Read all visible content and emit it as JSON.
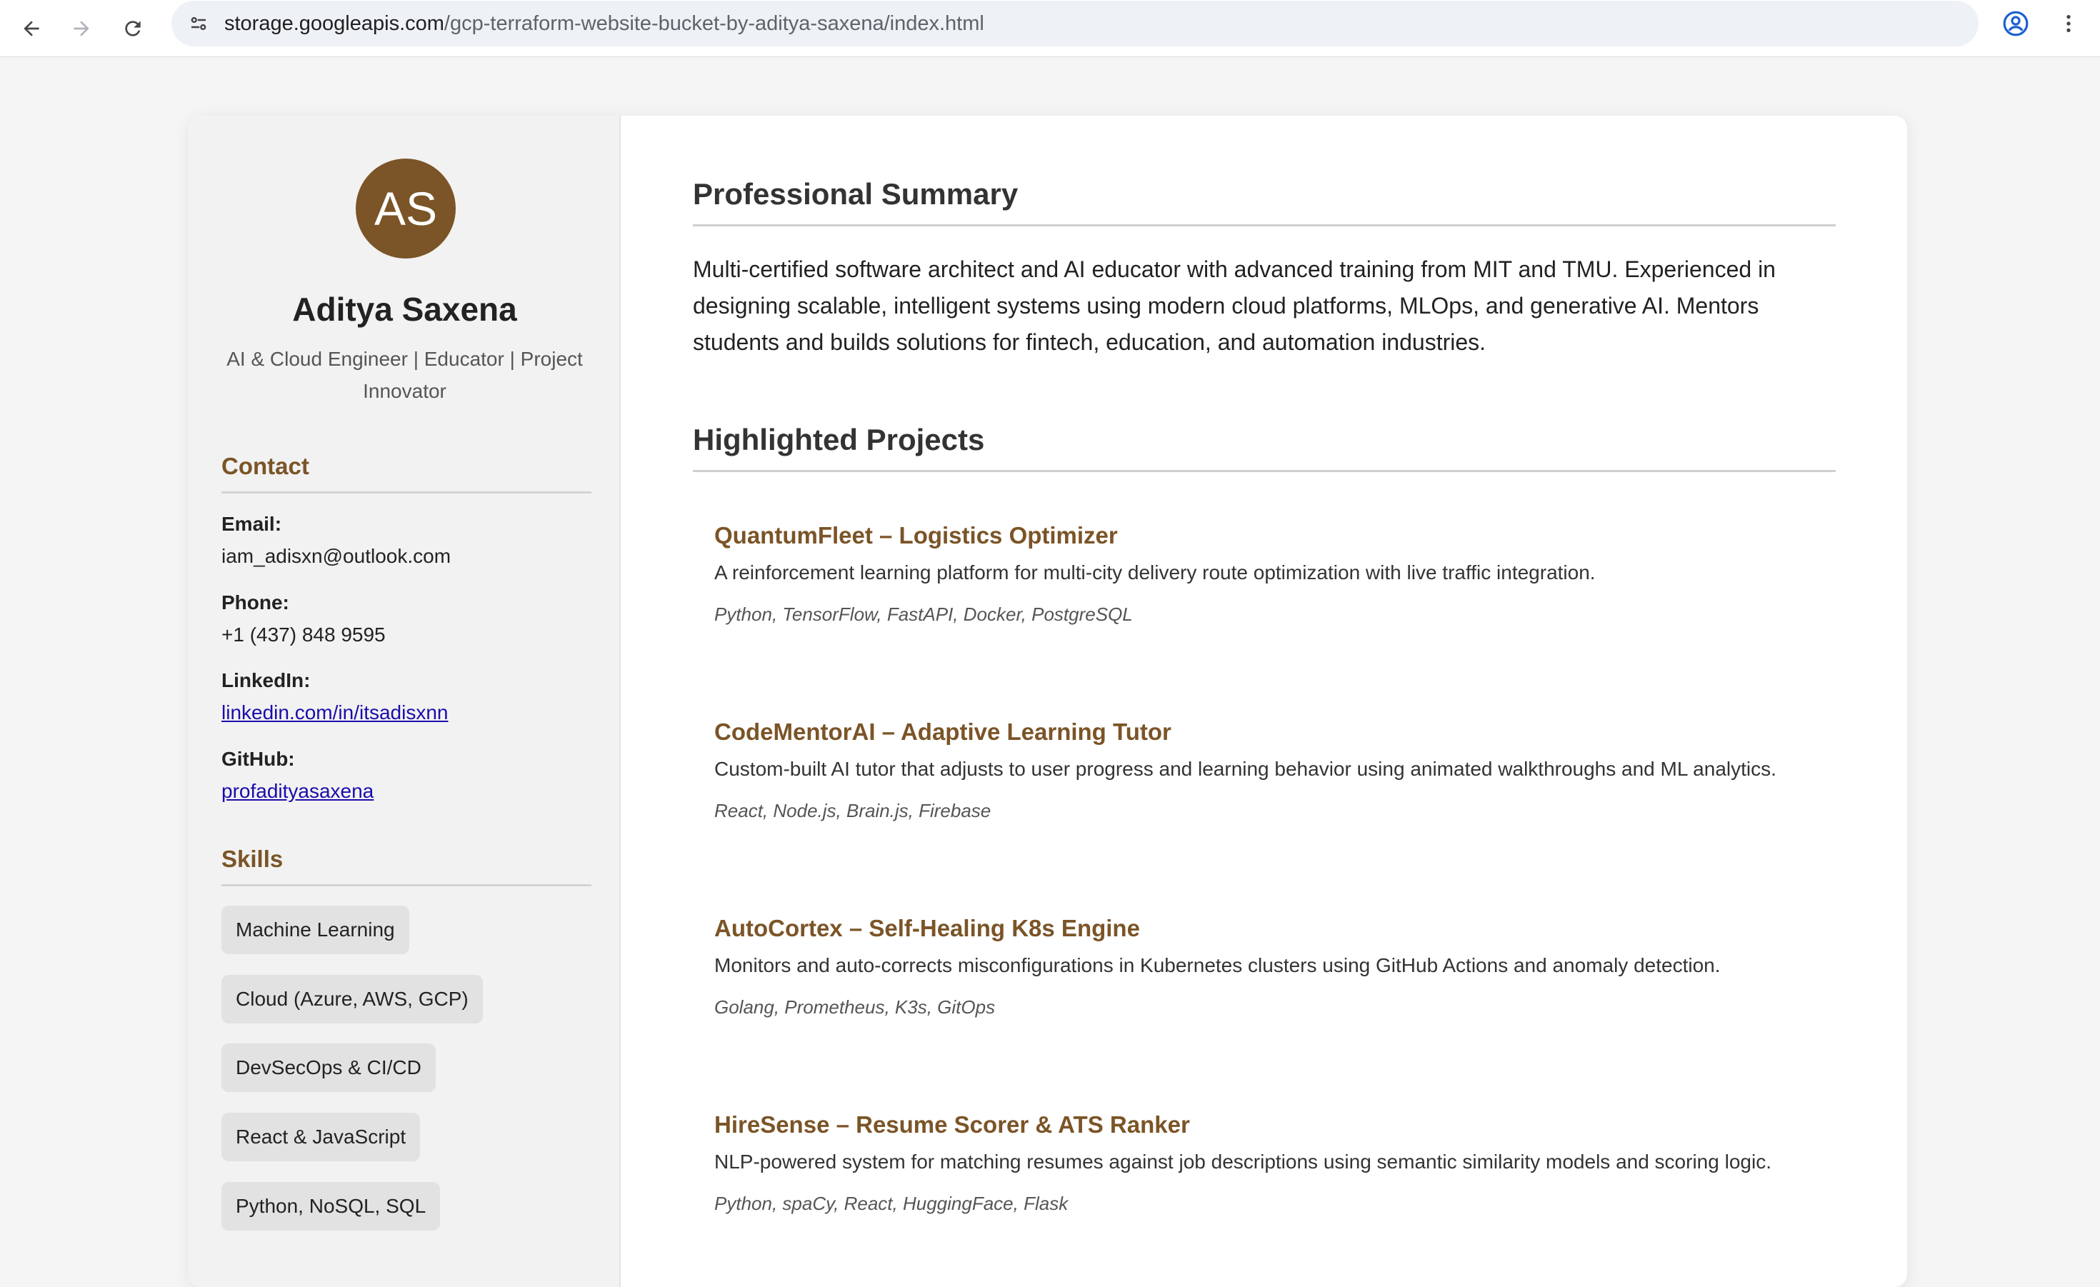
{
  "browser": {
    "url_host": "storage.googleapis.com",
    "url_path": "/gcp-terraform-website-bucket-by-aditya-saxena/index.html",
    "icons": [
      "back-arrow-icon",
      "forward-arrow-icon",
      "reload-icon",
      "site-info-icon",
      "star-icon",
      "profile-icon",
      "kebab-menu-icon"
    ]
  },
  "profile": {
    "initials": "AS",
    "name": "Aditya Saxena",
    "tagline": "AI & Cloud Engineer | Educator | Project Innovator"
  },
  "contact": {
    "heading": "Contact",
    "items": [
      {
        "label": "Email:",
        "value": "iam_adisxn@outlook.com"
      },
      {
        "label": "Phone:",
        "value": "+1 (437) 848 9595"
      },
      {
        "label": "LinkedIn:",
        "value": "linkedin.com/in/itsadisxnn"
      },
      {
        "label": "GitHub:",
        "value": "profadityasaxena"
      }
    ]
  },
  "skills": {
    "heading": "Skills",
    "items": [
      "Machine Learning",
      "Cloud (Azure, AWS, GCP)",
      "DevSecOps & CI/CD",
      "React & JavaScript",
      "Python, NoSQL, SQL"
    ]
  },
  "summary": {
    "heading": "Professional Summary",
    "text": "Multi-certified software architect and AI educator with advanced training from MIT and TMU. Experienced in designing scalable, intelligent systems using modern cloud platforms, MLOps, and generative AI. Mentors students and builds solutions for fintech, education, and automation industries."
  },
  "projects": {
    "heading": "Highlighted Projects",
    "items": [
      {
        "title": "QuantumFleet – Logistics Optimizer",
        "description": "A reinforcement learning platform for multi-city delivery route optimization with live traffic integration.",
        "tech": "Python, TensorFlow, FastAPI, Docker, PostgreSQL"
      },
      {
        "title": "CodeMentorAI – Adaptive Learning Tutor",
        "description": "Custom-built AI tutor that adjusts to user progress and learning behavior using animated walkthroughs and ML analytics.",
        "tech": "React, Node.js, Brain.js, Firebase"
      },
      {
        "title": "AutoCortex – Self-Healing K8s Engine",
        "description": "Monitors and auto-corrects misconfigurations in Kubernetes clusters using GitHub Actions and anomaly detection.",
        "tech": "Golang, Prometheus, K3s, GitOps"
      },
      {
        "title": "HireSense – Resume Scorer & ATS Ranker",
        "description": "NLP-powered system for matching resumes against job descriptions using semantic similarity models and scoring logic.",
        "tech": "Python, spaCy, React, HuggingFace, Flask"
      }
    ]
  },
  "colors": {
    "accent": "#7b5427",
    "link": "#1a0dab",
    "sidebar_bg": "#f2f2f2",
    "chip_bg": "#e2e2e2"
  }
}
